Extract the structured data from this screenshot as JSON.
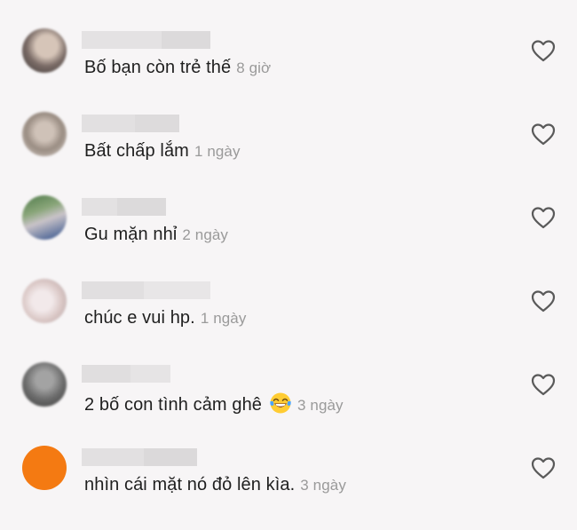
{
  "comments": [
    {
      "text": "Bố bạn còn trẻ thế",
      "time": "8 giờ",
      "avatar_colors": [
        "#7a6b66",
        "#c8b7a9",
        "#3e3a38"
      ]
    },
    {
      "text": "Bất chấp lắm",
      "time": "1 ngày",
      "avatar_colors": [
        "#9a8d83",
        "#d7cfc9",
        "#6b6259"
      ]
    },
    {
      "text": "Gu mặn nhỉ",
      "time": "2 ngày",
      "avatar_colors": [
        "#4f7a4a",
        "#c9c3c8",
        "#2e4e8a"
      ]
    },
    {
      "text": "chúc e vui hp.",
      "time": "1 ngày",
      "avatar_colors": [
        "#d9c6c4",
        "#f2e9ea",
        "#b2a3a6"
      ]
    },
    {
      "text": "2 bố con tình cảm ghê",
      "time": "3 ngày",
      "emoji": "laughing-tears-emoji",
      "avatar_colors": [
        "#6c6c6c",
        "#a3a3a3",
        "#3c3c3c"
      ]
    },
    {
      "text": "nhìn cái mặt nó đỏ lên kìa.",
      "time": "3 ngày",
      "avatar_colors": [
        "#f47a12"
      ]
    }
  ],
  "icons": {
    "like": "heart-outline-icon"
  },
  "colors": {
    "text": "#1f1f1f",
    "time": "#9a9a9a",
    "background": "#f7f5f6",
    "heart_stroke": "#5a5a5a"
  }
}
